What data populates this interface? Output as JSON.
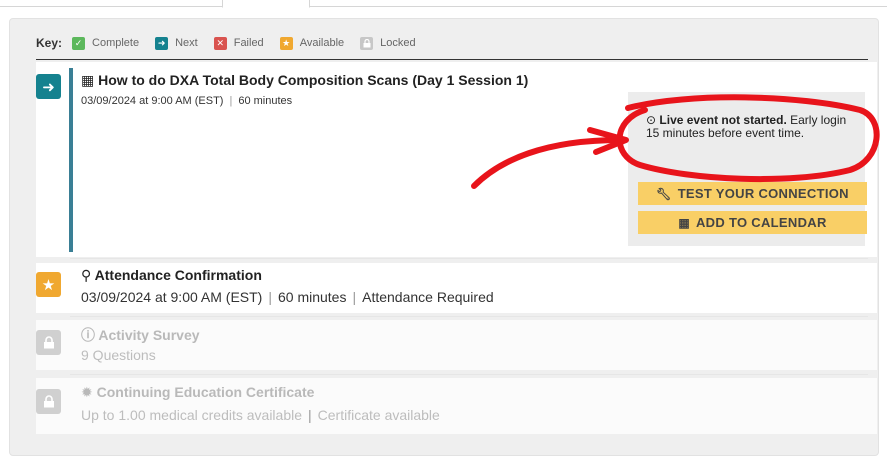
{
  "key": {
    "label": "Key:",
    "items": [
      {
        "label": "Complete",
        "icon": "check-icon",
        "color": "#5cb85c"
      },
      {
        "label": "Next",
        "icon": "arrow-right-icon",
        "color": "#15828f"
      },
      {
        "label": "Failed",
        "icon": "x-icon",
        "color": "#d9534f"
      },
      {
        "label": "Available",
        "icon": "star-icon",
        "color": "#f0a830"
      },
      {
        "label": "Locked",
        "icon": "lock-icon",
        "color": "#c7c7c7"
      }
    ]
  },
  "modules": [
    {
      "status": "Next",
      "title": "How to do DXA Total Body Composition Scans (Day 1 Session 1)",
      "date": "03/09/2024 at 9:00 AM (EST)",
      "duration": "60 minutes",
      "live_status_bold": "Live event not started.",
      "live_status_rest": "Early login 15 minutes before event time.",
      "buttons": {
        "test_connection": "TEST YOUR CONNECTION",
        "add_to_calendar": "ADD TO CALENDAR"
      }
    },
    {
      "status": "Available",
      "title": "Attendance Confirmation",
      "date": "03/09/2024 at 9:00 AM (EST)",
      "duration": "60 minutes",
      "requirement": "Attendance Required"
    },
    {
      "status": "Locked",
      "title": "Activity Survey",
      "detail": "9 Questions"
    },
    {
      "status": "Locked",
      "title": "Continuing Education Certificate",
      "credits": "Up to 1.00 medical credits available",
      "certificate": "Certificate available"
    }
  ],
  "colors": {
    "accent_next": "#15828f",
    "accent_available": "#f0a830",
    "button_yellow": "#f9cf66",
    "annotation_red": "#e8141b"
  }
}
